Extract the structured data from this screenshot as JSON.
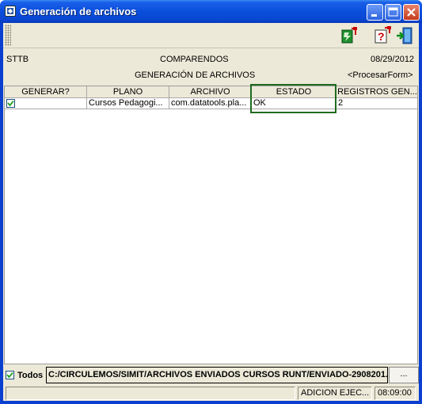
{
  "window": {
    "title": "Generación de archivos"
  },
  "header": {
    "left": "STTB",
    "center_title": "COMPARENDOS",
    "date": "08/29/2012",
    "subtitle": "GENERACIÓN DE ARCHIVOS",
    "form": "<ProcesarForm>"
  },
  "table": {
    "columns": [
      "GENERAR?",
      "PLANO",
      "ARCHIVO",
      "ESTADO",
      "REGISTROS GEN..."
    ],
    "rows": [
      {
        "generar": true,
        "plano": "Cursos Pedagogi...",
        "archivo": "com.datatools.pla...",
        "estado": "OK",
        "registros": "2"
      }
    ]
  },
  "footer": {
    "todos_label": "Todos",
    "todos_checked": true,
    "path": "C:/CIRCULEMOS/SIMIT/ARCHIVOS ENVIADOS CURSOS RUNT/ENVIADO-2908201...",
    "browse_label": "..."
  },
  "status": {
    "message": "",
    "mode": "ADICION EJEC...",
    "time": "08:09:00"
  },
  "icons": [
    "window-icon",
    "minimize-icon",
    "maximize-icon",
    "close-icon",
    "process-icon",
    "help-icon",
    "exit-icon",
    "checkbox-check-icon"
  ],
  "colors": {
    "highlight": "#1f6b1f",
    "title_bar": "#0a4fdc",
    "face": "#ece9d8"
  }
}
